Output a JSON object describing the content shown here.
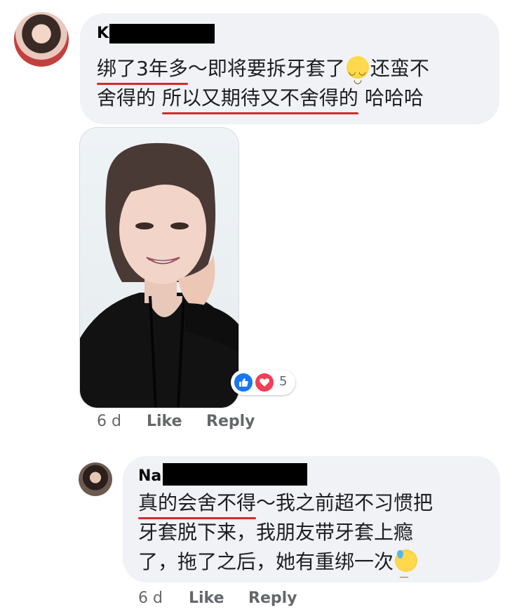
{
  "comments": [
    {
      "author_visible": "K",
      "text_parts": [
        {
          "t": "绑了3年多",
          "u": true
        },
        {
          "t": "～即将要拆牙套了",
          "u": false
        },
        {
          "t": "还蛮不",
          "u": false
        },
        {
          "t": "舍得的 ",
          "u": false
        },
        {
          "t": "所以又期待又不舍得的",
          "u": true
        },
        {
          "t": " 哈哈哈",
          "u": false
        }
      ],
      "emoji": "smiling-face",
      "reaction_count": "5",
      "time": "6 d",
      "like_label": "Like",
      "reply_label": "Reply"
    },
    {
      "author_visible": "Na",
      "text_parts": [
        {
          "t": "真的会舍不得",
          "u": true
        },
        {
          "t": "～我之前超不习惯把",
          "u": false
        },
        {
          "t": "牙套脱下来，我朋友带牙套上瘾",
          "u": false
        },
        {
          "t": "了，拖了之后，她有重绑一次",
          "u": false
        }
      ],
      "emoji": "sweat-face",
      "time": "6 d",
      "like_label": "Like",
      "reply_label": "Reply"
    }
  ],
  "colors": {
    "bubble_bg": "#f0f2f5",
    "meta_text": "#65676b",
    "underline": "#d42a2a",
    "like_blue": "#1877f2",
    "love_red": "#f33e58"
  }
}
